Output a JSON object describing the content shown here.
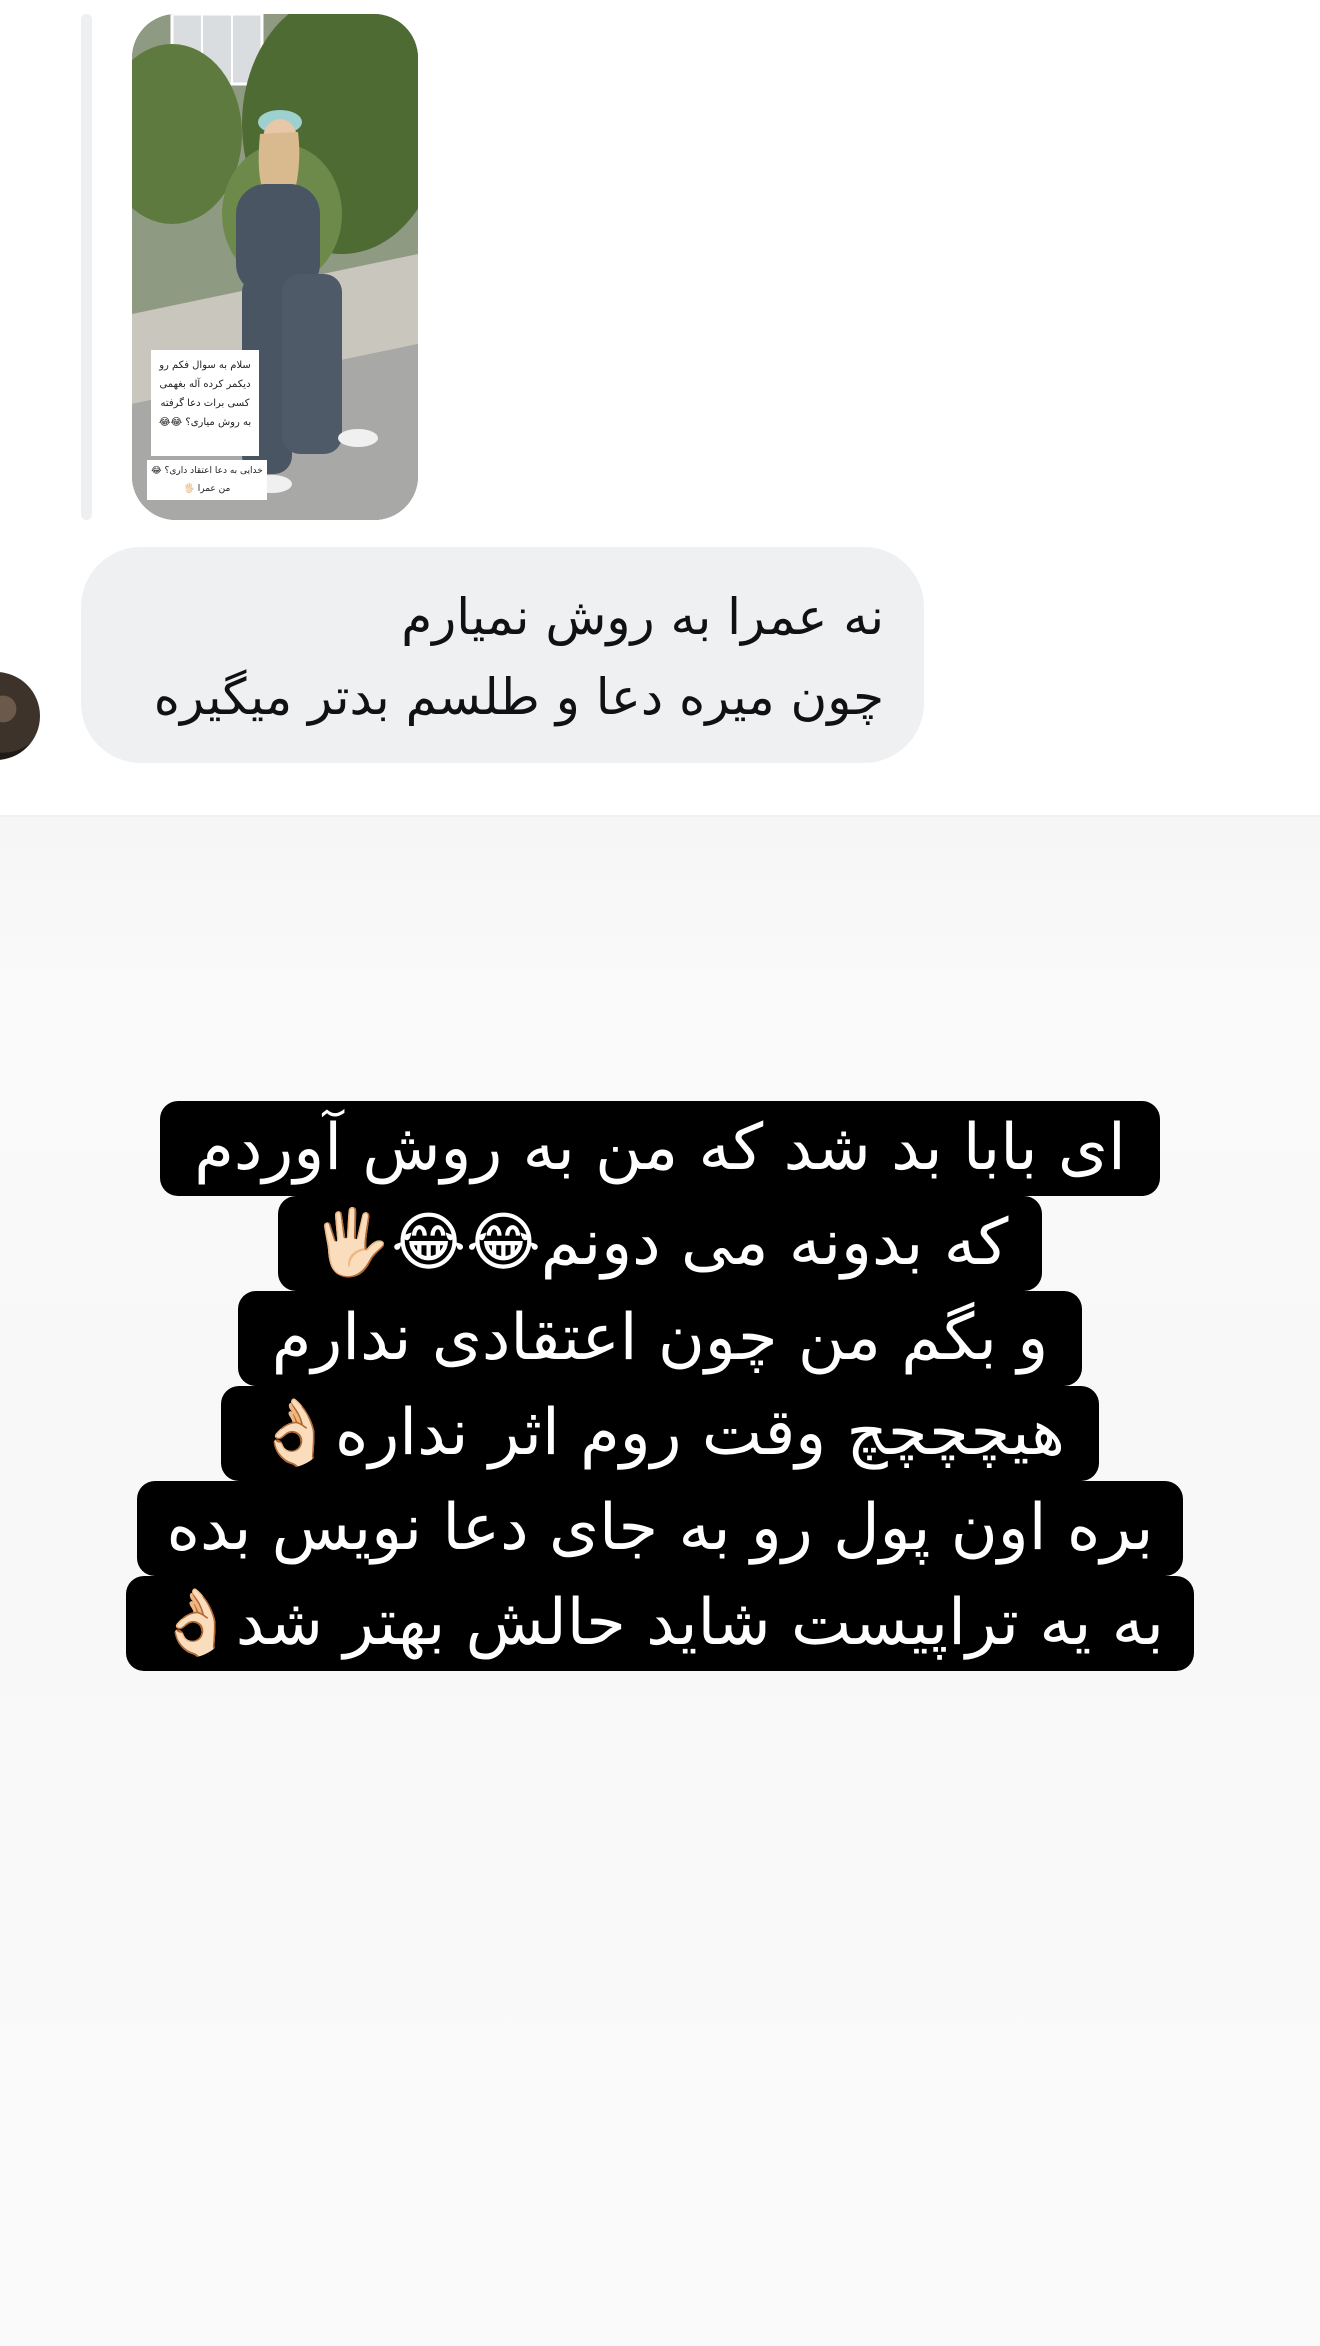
{
  "reply": {
    "image_caption_main": "سلام به سوال فکم رو دیکمر کرده آله بغهمی کسی برات دعا گرفته به روش میاری؟ 😂😂",
    "image_caption_sub": "خدایی به دعا اعتقاد داری؟ 😂 من عمرا 🖐🏻"
  },
  "message": {
    "lines": [
      "نه عمرا به روش نمیارم",
      "چون میره دعا و طلسم بدتر میگیره"
    ]
  },
  "story": {
    "lines": [
      "ای بابا بد شد که من به روش آوردم",
      "که بدونه می دونم😂😂🖐🏻",
      "و بگم من چون اعتقادی ندارم",
      "هیچچچچ وقت روم اثر نداره👌🏻",
      "بره اون پول رو به جای دعا نویس بده",
      "به یه تراپیست شاید حالش بهتر شد👌🏻"
    ]
  },
  "colors": {
    "bubble": "#eff0f2",
    "story_background": "#fafafa",
    "story_highlight": "#000000",
    "story_text": "#ffffff"
  }
}
